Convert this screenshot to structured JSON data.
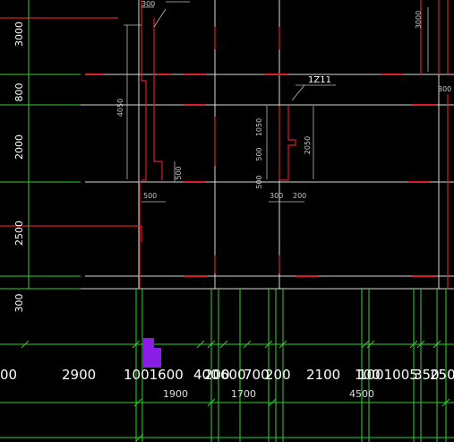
{
  "app": {
    "background": "#000000"
  },
  "colors": {
    "wall": "#e8e8e8",
    "column": "#d81e28",
    "dim_left": "#2fd12f",
    "dim_bottom": "#2fd12f",
    "text": "#ffffff",
    "cad_text": "#c8c8c8",
    "highlight": "#8a1ee6"
  },
  "left_dimensions": [
    {
      "label": "3000"
    },
    {
      "label": "800"
    },
    {
      "label": "2000"
    },
    {
      "label": "2500"
    },
    {
      "label": "300"
    }
  ],
  "bottom_dimension_row": [
    {
      "label": "00"
    },
    {
      "label": "2900"
    },
    {
      "label": "1001600"
    },
    {
      "label": "400"
    },
    {
      "label": "200"
    },
    {
      "label": "600"
    },
    {
      "label": "700"
    },
    {
      "label": "200"
    },
    {
      "label": "2100"
    },
    {
      "label": "100"
    },
    {
      "label": "1001005"
    },
    {
      "label": "350"
    },
    {
      "label": "250"
    }
  ],
  "bottom_subtotals": [
    {
      "label": "1900"
    },
    {
      "label": "1700"
    },
    {
      "label": "4500"
    }
  ],
  "plan_labels": {
    "top_right_3000": "3000",
    "top_left_300": "300",
    "left_4050": "4050",
    "mid_500": "500",
    "lower_500": "500",
    "right_1050": "1050",
    "right_500": "500",
    "right_2050": "2050",
    "right_500b": "500",
    "right_300": "300",
    "right_200": "200",
    "far_right_300": "300",
    "callout": "1Z11"
  },
  "icons": {
    "highlight_block": "selection-marker-icon"
  }
}
